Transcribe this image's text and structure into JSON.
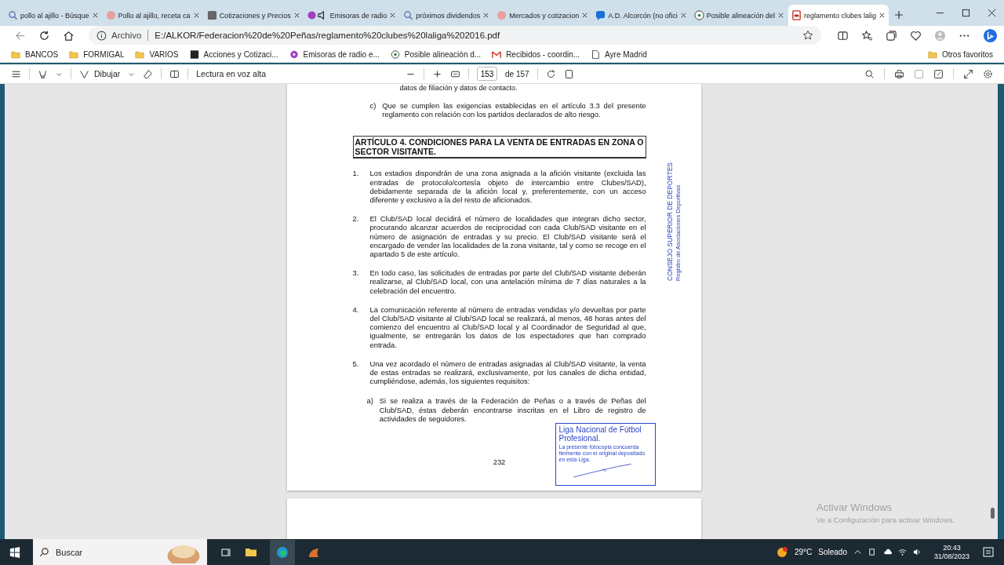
{
  "tabs": [
    {
      "title": "pollo al ajillo - Búsque",
      "kind": "search",
      "selected": false
    },
    {
      "title": "Pollo al ajillo, receta ca",
      "kind": "site",
      "selected": false
    },
    {
      "title": "Cotizaciones y Precios",
      "kind": "inv",
      "selected": false
    },
    {
      "title": "Emisoras de radio",
      "kind": "audio",
      "selected": false
    },
    {
      "title": "próximos dividendos",
      "kind": "search",
      "selected": false
    },
    {
      "title": "Mercados y cotizacion",
      "kind": "site",
      "selected": false
    },
    {
      "title": "A.D. Alcorcón (no ofici",
      "kind": "chat",
      "selected": false
    },
    {
      "title": "Posible alineación del",
      "kind": "ball",
      "selected": false
    },
    {
      "title": "reglamento clubes lalig",
      "kind": "pdf",
      "selected": true
    }
  ],
  "address_bar": {
    "scheme_label": "Archivo",
    "url": "E:/ALKOR/Federacion%20de%20Peñas/reglamento%20clubes%20laliga%202016.pdf"
  },
  "bookmarks": [
    {
      "label": "BANCOS",
      "kind": "folder"
    },
    {
      "label": "FORMIGAL",
      "kind": "folder"
    },
    {
      "label": "VARIOS",
      "kind": "folder"
    },
    {
      "label": "Acciones y Cotizaci...",
      "kind": "inv"
    },
    {
      "label": "Emisoras de radio e...",
      "kind": "radio"
    },
    {
      "label": "Posible alineación d...",
      "kind": "ball"
    },
    {
      "label": "Recibidos - coordin...",
      "kind": "mail"
    },
    {
      "label": "Ayre Madrid",
      "kind": "page"
    }
  ],
  "other_bookmarks": "Otros favoritos",
  "pdf_toolbar": {
    "draw_label": "Dibujar",
    "read_aloud_label": "Lectura en voz alta",
    "page_number": "153",
    "page_total": "de 157"
  },
  "document": {
    "cut_line": "datos de filiación y datos de contacto.",
    "item_c": {
      "marker": "c)",
      "text": "Que se cumplen las exigencias establecidas en el artículo 3.3 del presente reglamento con relación con los partidos declarados de alto riesgo."
    },
    "heading": "ARTÍCULO 4. CONDICIONES PARA LA VENTA DE ENTRADAS EN ZONA O SECTOR VISITANTE.",
    "numbered": [
      {
        "number": "1.",
        "text": "Los estadios dispondrán de una zona asignada a la afición visitante (excluida las entradas de protocolo/cortesía objeto de intercambio entre Clubes/SAD), debidamente separada de la afición local y, preferentemente, con un acceso diferente y exclusivo a la del resto de aficionados."
      },
      {
        "number": "2.",
        "text": "El Club/SAD local decidirá el número de localidades que integran dicho sector, procurando alcanzar acuerdos de reciprocidad con cada Club/SAD visitante en el número de asignación de entradas y su precio. El Club/SAD visitante será el encargado de vender las localidades de la zona visitante, tal y como se recoge en el apartado 5 de este artículo."
      },
      {
        "number": "3.",
        "text": "En todo caso, las solicitudes de entradas por parte del Club/SAD visitante deberán realizarse, al Club/SAD local, con una antelación mínima de 7 días naturales a la celebración del encuentro."
      },
      {
        "number": "4.",
        "text": "La comunicación referente al número de entradas vendidas y/o devueltas por parte del Club/SAD visitante al Club/SAD local se realizará, al menos, 48 horas antes del comienzo del encuentro al Club/SAD local y al Coordinador de Seguridad al que, igualmente, se entregarán los datos de los espectadores que han comprado entrada."
      },
      {
        "number": "5.",
        "text": "Una vez acordado el número de entradas asignadas al Club/SAD visitante, la venta de estas entradas se realizará, exclusivamente, por los canales de dicha entidad, cumpliéndose, además, los siguientes requisitos:"
      }
    ],
    "item_a": {
      "marker": "a)",
      "text": "Si se realiza a través de la Federación de Peñas o a través de Peñas del Club/SAD, éstas deberán encontrarse inscritas en el Libro de registro de actividades de seguidores."
    },
    "page_number": "232",
    "side_stamp": {
      "line_1": "CONSEJO SUPERIOR DE DEPORTES",
      "line_2": "Registro de Asociaciones Deportivas"
    },
    "stamp": {
      "title": "Liga Nacional de Fútbol Profesional.",
      "body": "La presente fotocopia concuerda fielmente con el original depositado en esta Liga."
    }
  },
  "activation_notice": {
    "title": "Activar Windows",
    "subtitle": "Ve a Configuración para activar Windows."
  },
  "taskbar": {
    "search_placeholder": "Buscar",
    "weather": "29°C",
    "weather_text": "Soleado",
    "time": "20:43",
    "date": "31/08/2023"
  }
}
